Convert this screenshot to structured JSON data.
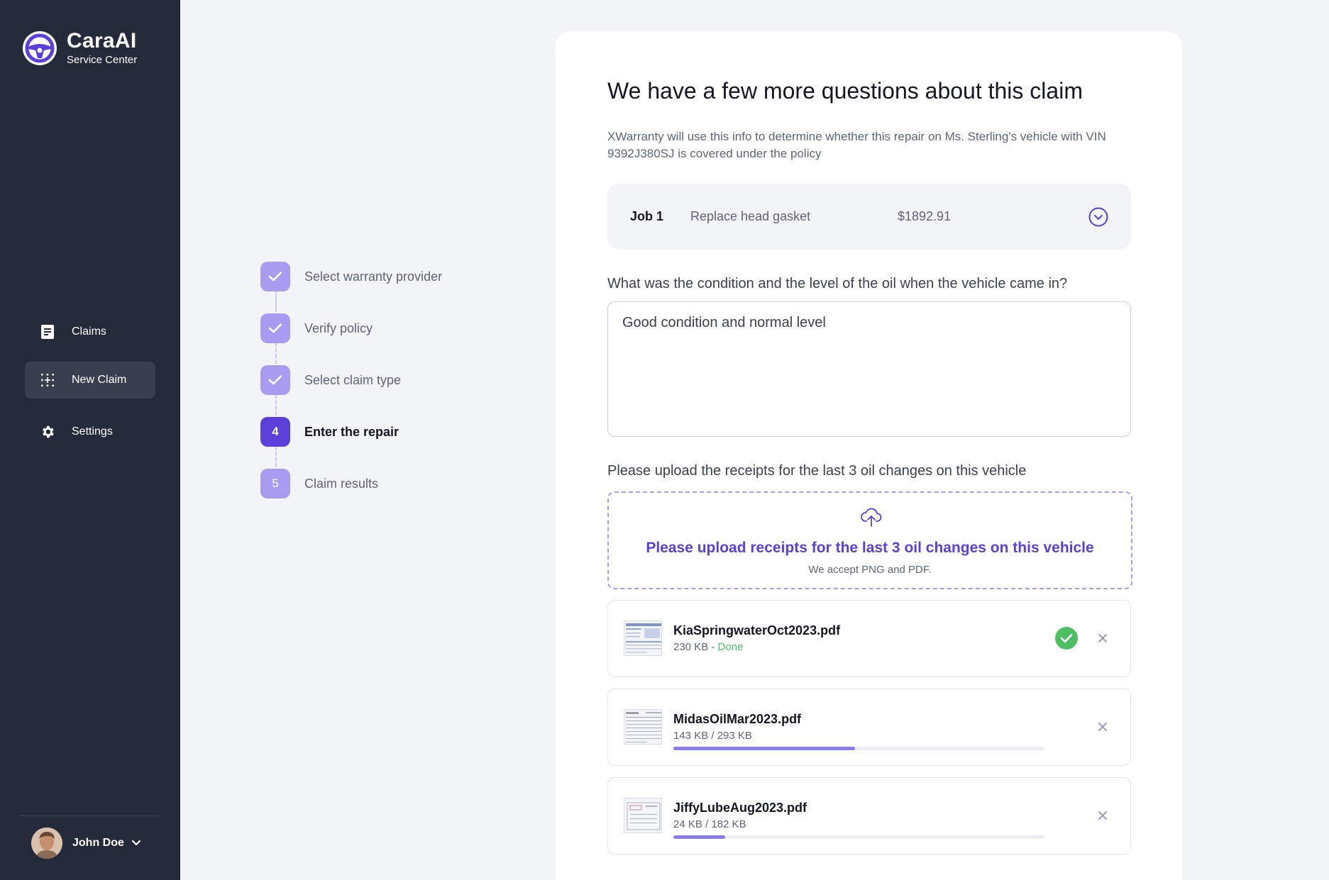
{
  "brand": {
    "name": "CaraAI",
    "subtitle": "Service Center"
  },
  "nav": {
    "items": [
      {
        "label": "Claims",
        "icon": "document-icon",
        "active": false
      },
      {
        "label": "New Claim",
        "icon": "grid-plus-icon",
        "active": true
      },
      {
        "label": "Settings",
        "icon": "gear-icon",
        "active": false
      }
    ]
  },
  "user": {
    "name": "John Doe"
  },
  "steps": [
    {
      "label": "Select warranty provider",
      "state": "done"
    },
    {
      "label": "Verify policy",
      "state": "done"
    },
    {
      "label": "Select claim type",
      "state": "done"
    },
    {
      "label": "Enter the repair",
      "state": "current",
      "number": "4"
    },
    {
      "label": "Claim results",
      "state": "future",
      "number": "5"
    }
  ],
  "main": {
    "title": "We have a few more questions about this claim",
    "subtitle": "XWarranty will use this info to determine whether this repair on Ms. Sterling's vehicle with VIN 9392J380SJ is covered under the policy",
    "job": {
      "number": "Job 1",
      "description": "Replace head gasket",
      "price": "$1892.91"
    },
    "question": "What was the condition and the level of the oil when the vehicle came in?",
    "answer": "Good condition and normal level",
    "upload_question": "Please upload the receipts for the last 3 oil changes on this vehicle",
    "dropzone": {
      "main": "Please upload receipts for the last 3 oil changes on this vehicle",
      "sub": "We accept PNG and PDF."
    },
    "files": [
      {
        "name": "KiaSpringwaterOct2023.pdf",
        "size": "230 KB - ",
        "status": "Done",
        "complete": true
      },
      {
        "name": "MidasOilMar2023.pdf",
        "size": "143 KB / 293 KB",
        "progress": 0.49,
        "complete": false
      },
      {
        "name": "JiffyLubeAug2023.pdf",
        "size": "24 KB / 182 KB",
        "progress": 0.14,
        "complete": false
      }
    ]
  },
  "colors": {
    "sidebar": "#252a3a",
    "accent": "#5a3fd9",
    "accent_light": "#a99cf0",
    "success": "#4fbf65"
  }
}
